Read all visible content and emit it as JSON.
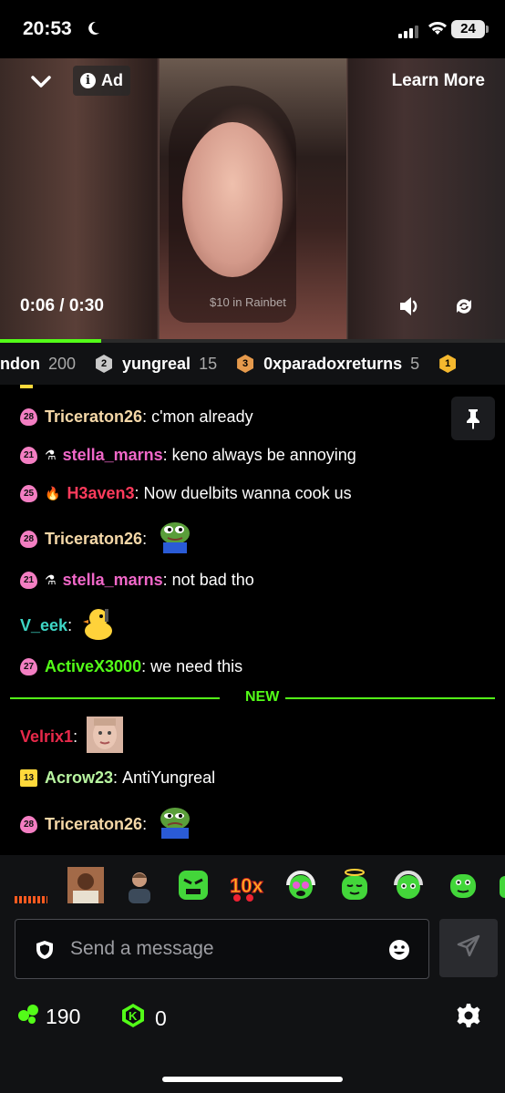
{
  "status_bar": {
    "time": "20:53",
    "battery": "24"
  },
  "video": {
    "ad_label": "Ad",
    "learn_more": "Learn More",
    "time": "0:06 / 0:30",
    "caption": "$10 in Rainbet",
    "progress_fraction": 0.2
  },
  "leaderboard": [
    {
      "name": "ndon",
      "points": "200",
      "rank": ""
    },
    {
      "name": "yungreal",
      "points": "15",
      "rank": "2",
      "color": "#c9c9c9"
    },
    {
      "name": "0xparadoxreturns",
      "points": "5",
      "rank": "3",
      "color": "#e69a4c"
    },
    {
      "name": "",
      "points": "",
      "rank": "1",
      "color": "#f5b82e"
    }
  ],
  "chat": {
    "messages": [
      {
        "badge": "28",
        "user": "Triceraton26",
        "color": "#f5d8a8",
        "text": "c'mon already"
      },
      {
        "badge": "21",
        "user": "stella_marns",
        "color": "#f067c8",
        "text": "keno always be annoying"
      },
      {
        "badge": "25",
        "user": "H3aven3",
        "color": "#ff3b5c",
        "text": "Now duelbits wanna cook us"
      },
      {
        "badge": "28",
        "user": "Triceraton26",
        "color": "#f5d8a8",
        "text": ""
      },
      {
        "badge": "21",
        "user": "stella_marns",
        "color": "#f067c8",
        "text": "not bad tho"
      },
      {
        "badge": "",
        "user": "V_eek",
        "color": "#3ed6c5",
        "text": ""
      },
      {
        "badge": "27",
        "user": "ActiveX3000",
        "color": "#53fc18",
        "text": "we need this"
      },
      {
        "badge": "",
        "user": "Velrix1",
        "color": "#e8294a",
        "text": ""
      },
      {
        "badge": "13",
        "user": "Acrow23",
        "color": "#b8f5a0",
        "text": "AntiYungreal"
      },
      {
        "badge": "28",
        "user": "Triceraton26",
        "color": "#f5d8a8",
        "text": ""
      }
    ],
    "new_label": "NEW",
    "colon": ":"
  },
  "composer": {
    "placeholder": "Send a message",
    "points_balance": "190",
    "kick_balance": "0"
  },
  "colors": {
    "accent": "#53fc18",
    "background": "#000000",
    "panel": "#111214"
  }
}
